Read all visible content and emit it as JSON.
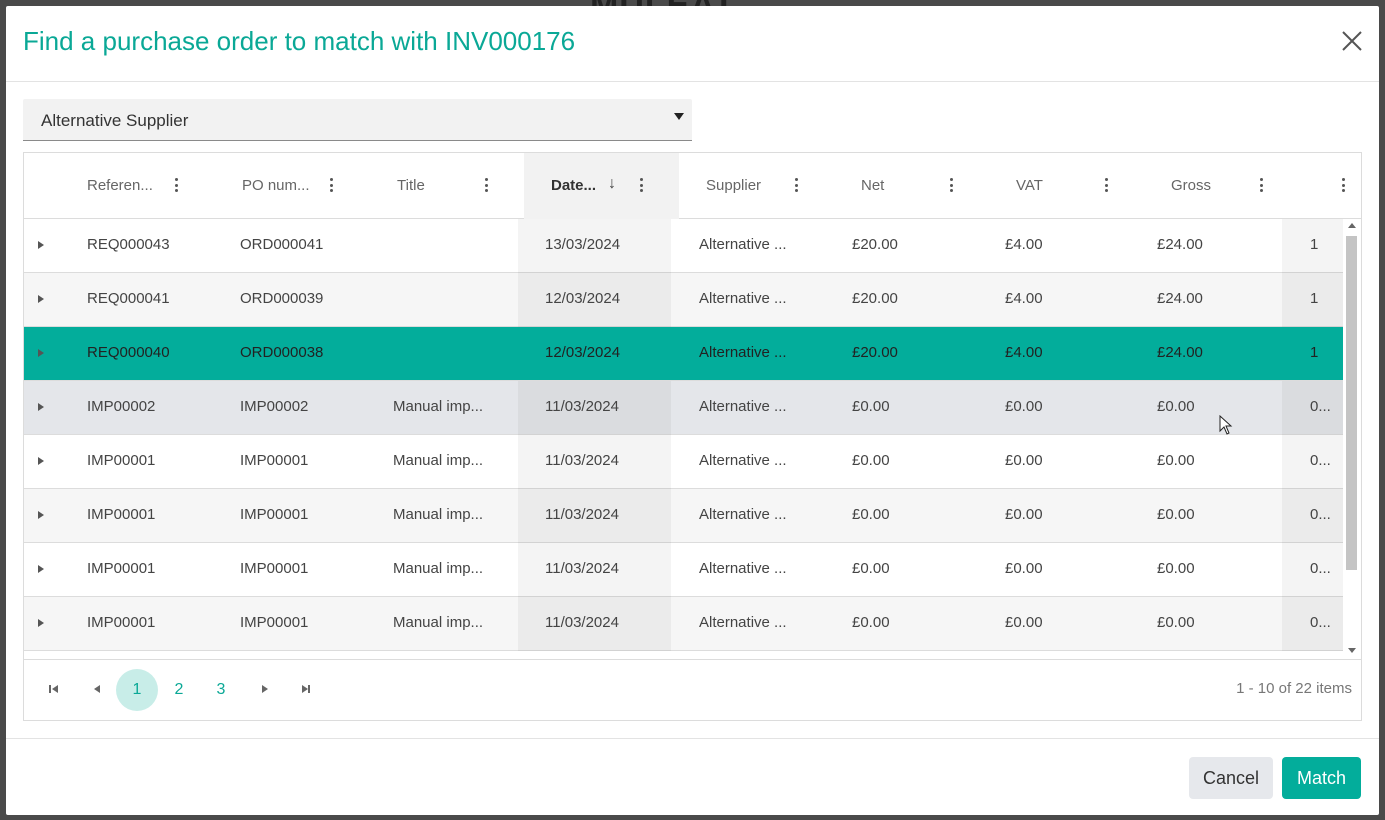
{
  "dialog": {
    "title": "Find a purchase order to match with INV000176"
  },
  "filter": {
    "supplier_value": "Alternative Supplier"
  },
  "grid": {
    "columns": [
      {
        "label": "Referen...",
        "sorted": false
      },
      {
        "label": "PO num...",
        "sorted": false
      },
      {
        "label": "Title",
        "sorted": false
      },
      {
        "label": "Date...",
        "sorted": true,
        "sort_direction": "descending"
      },
      {
        "label": "Supplier",
        "sorted": false
      },
      {
        "label": "Net",
        "sorted": false
      },
      {
        "label": "VAT",
        "sorted": false
      },
      {
        "label": "Gross",
        "sorted": false
      },
      {
        "label": "",
        "sorted": false
      }
    ],
    "rows": [
      {
        "reference": "REQ000043",
        "po_number": "ORD000041",
        "title": "",
        "date": "13/03/2024",
        "supplier": "Alternative ...",
        "net": "£20.00",
        "vat": "£4.00",
        "gross": "£24.00",
        "extra": "1",
        "state": "normal"
      },
      {
        "reference": "REQ000041",
        "po_number": "ORD000039",
        "title": "",
        "date": "12/03/2024",
        "supplier": "Alternative ...",
        "net": "£20.00",
        "vat": "£4.00",
        "gross": "£24.00",
        "extra": "1",
        "state": "alt"
      },
      {
        "reference": "REQ000040",
        "po_number": "ORD000038",
        "title": "",
        "date": "12/03/2024",
        "supplier": "Alternative ...",
        "net": "£20.00",
        "vat": "£4.00",
        "gross": "£24.00",
        "extra": "1",
        "state": "selected"
      },
      {
        "reference": "IMP00002",
        "po_number": "IMP00002",
        "title": "Manual imp...",
        "date": "11/03/2024",
        "supplier": "Alternative ...",
        "net": "£0.00",
        "vat": "£0.00",
        "gross": "£0.00",
        "extra": "0...",
        "state": "hover"
      },
      {
        "reference": "IMP00001",
        "po_number": "IMP00001",
        "title": "Manual imp...",
        "date": "11/03/2024",
        "supplier": "Alternative ...",
        "net": "£0.00",
        "vat": "£0.00",
        "gross": "£0.00",
        "extra": "0...",
        "state": "normal"
      },
      {
        "reference": "IMP00001",
        "po_number": "IMP00001",
        "title": "Manual imp...",
        "date": "11/03/2024",
        "supplier": "Alternative ...",
        "net": "£0.00",
        "vat": "£0.00",
        "gross": "£0.00",
        "extra": "0...",
        "state": "alt"
      },
      {
        "reference": "IMP00001",
        "po_number": "IMP00001",
        "title": "Manual imp...",
        "date": "11/03/2024",
        "supplier": "Alternative ...",
        "net": "£0.00",
        "vat": "£0.00",
        "gross": "£0.00",
        "extra": "0...",
        "state": "normal"
      },
      {
        "reference": "IMP00001",
        "po_number": "IMP00001",
        "title": "Manual imp...",
        "date": "11/03/2024",
        "supplier": "Alternative ...",
        "net": "£0.00",
        "vat": "£0.00",
        "gross": "£0.00",
        "extra": "0...",
        "state": "alt"
      }
    ]
  },
  "pager": {
    "pages": [
      "1",
      "2",
      "3"
    ],
    "current_page": "1",
    "info": "1 - 10 of 22 items"
  },
  "footer": {
    "cancel_label": "Cancel",
    "match_label": "Match"
  },
  "colors": {
    "accent": "#0aa896",
    "selected_row": "#03ad9b",
    "hover_row": "#e4e6ea"
  }
}
